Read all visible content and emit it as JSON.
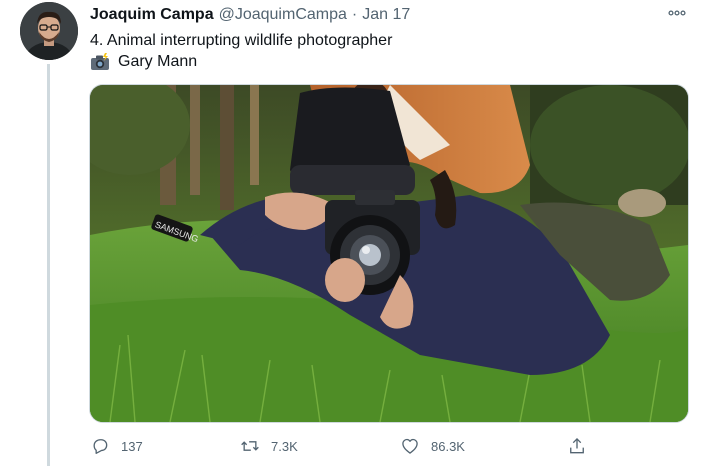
{
  "tweet": {
    "author": {
      "display_name": "Joaquim Campa",
      "handle": "@JoaquimCampa",
      "avatar_icon": "profile-photo"
    },
    "separator": "·",
    "date": "Jan 17",
    "text": "4. Animal interrupting wildlife photographer",
    "credit": {
      "icon": "camera-with-flash-emoji",
      "name": "Gary Mann"
    },
    "media": {
      "alt": "Photo of a fox climbing on a wildlife photographer lying in the grass",
      "camera_brand_text": "SAMSUNG"
    },
    "actions": {
      "reply_count": "137",
      "retweet_count": "7.3K",
      "like_count": "86.3K"
    },
    "colors": {
      "text_primary": "#0f1419",
      "text_secondary": "#536471",
      "thread_line": "#cfd9de"
    }
  }
}
